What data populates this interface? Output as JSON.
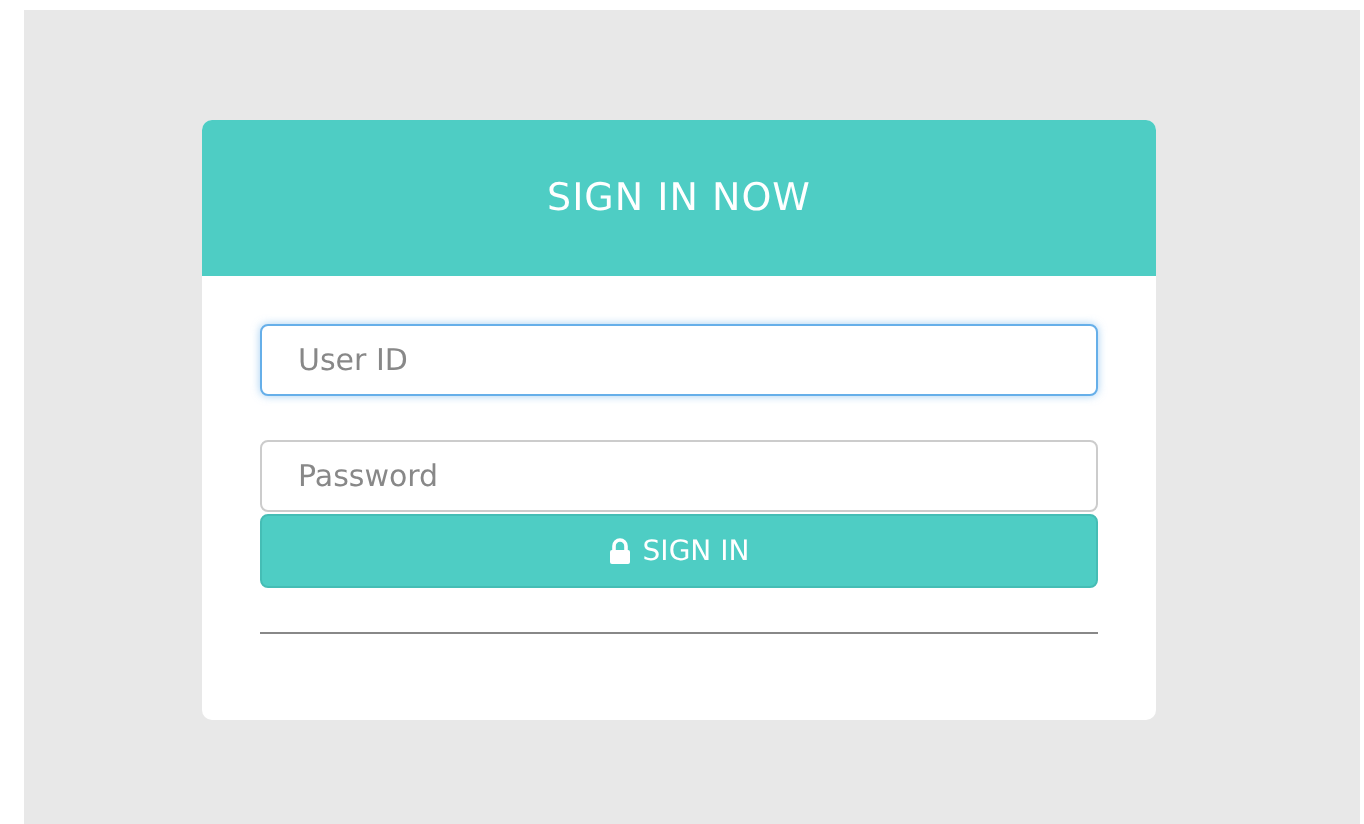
{
  "card": {
    "title": "SIGN IN NOW"
  },
  "fields": [
    {
      "placeholder": "User ID",
      "focused": true
    },
    {
      "placeholder": "Password",
      "focused": false
    }
  ],
  "button": {
    "label": "SIGN IN"
  }
}
